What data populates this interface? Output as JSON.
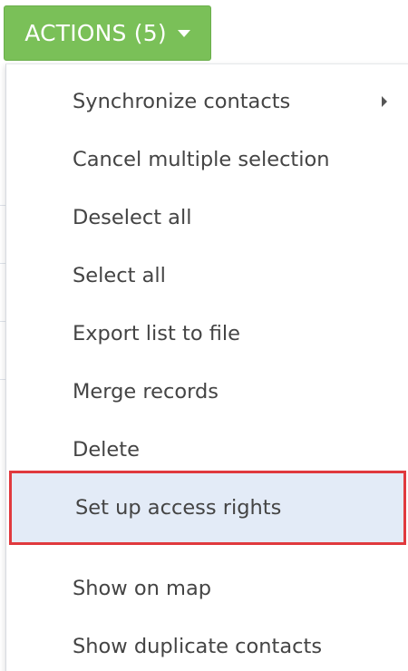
{
  "actions_button": {
    "label": "ACTIONS (5)",
    "icon": "caret-down-icon",
    "color": "#7ac058"
  },
  "menu": {
    "items": [
      {
        "label": "Synchronize contacts",
        "has_submenu": true
      },
      {
        "label": "Cancel multiple selection"
      },
      {
        "label": "Deselect all"
      },
      {
        "label": "Select all"
      },
      {
        "label": "Export list to file"
      },
      {
        "label": "Merge records"
      },
      {
        "label": "Delete"
      },
      {
        "label": "Set up access rights",
        "highlighted": true
      },
      {
        "label": "Show on map"
      },
      {
        "label": "Show duplicate contacts"
      }
    ],
    "highlight_border_color": "#e0393e",
    "highlight_background": "#e3ebf7"
  }
}
